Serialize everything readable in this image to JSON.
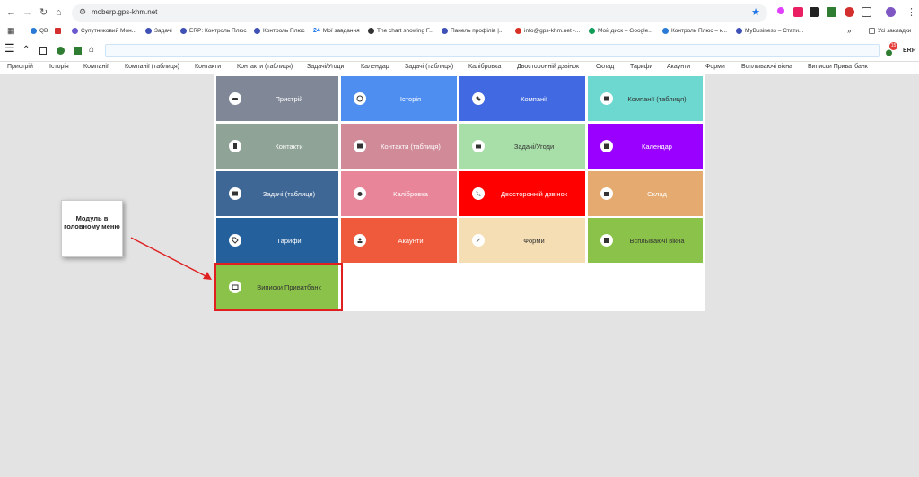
{
  "browser": {
    "url": "moberp.gps-khm.net",
    "bookmarks": [
      {
        "label": "QB",
        "color": "#2a7ad6"
      },
      {
        "label": "Супутниковий Мон...",
        "color": "#6a5acd"
      },
      {
        "label": "Задачі",
        "color": "#3f51b5"
      },
      {
        "label": "ERP: Контроль Плюс",
        "color": "#3f51b5"
      },
      {
        "label": "Контроль Плюс",
        "color": "#3f51b5"
      },
      {
        "label": "Мої завдання",
        "color": "#1a73e8"
      },
      {
        "label": "The chart showing F...",
        "color": "#333333"
      },
      {
        "label": "Панель профілів |...",
        "color": "#3f51b5"
      },
      {
        "label": "info@gps-khm.net -...",
        "color": "#d93025"
      },
      {
        "label": "Мой диск – Google...",
        "color": "#0f9d58"
      },
      {
        "label": "Контроль Плюс – к...",
        "color": "#2a7ad6"
      },
      {
        "label": "MyBusiness – Стати...",
        "color": "#3f51b5"
      }
    ],
    "all_bookmarks": "Усі закладки",
    "bookmark_24": "24"
  },
  "app": {
    "erp_label": "ERP",
    "notification_count": "15",
    "menu": [
      "Пристрій",
      "Історія",
      "Компанії",
      "Компанії (таблиця)",
      "Контакти",
      "Контакти (таблиця)",
      "Задачі/Угоди",
      "Календар",
      "Задачі (таблиця)",
      "Калібровка",
      "Двосторонній дзвінок",
      "Склад",
      "Тарифи",
      "Акаунти",
      "Форми",
      "Всплываючі вікна",
      "Виписки Приватбанк"
    ]
  },
  "modules": [
    {
      "label": "Пристрій",
      "color": "#808898",
      "text_color": "#ffffff",
      "icon": "car-icon"
    },
    {
      "label": "Історія",
      "color": "#4d8ef0",
      "text_color": "#ffffff",
      "icon": "history-icon"
    },
    {
      "label": "Компанії",
      "color": "#4169e1",
      "text_color": "#ffffff",
      "icon": "company-icon"
    },
    {
      "label": "Компанії (таблиця)",
      "color": "#6dd8d0",
      "text_color": "#333333",
      "icon": "table-icon"
    },
    {
      "label": "Контакти",
      "color": "#8fa396",
      "text_color": "#ffffff",
      "icon": "contact-icon"
    },
    {
      "label": "Контакти (таблиця)",
      "color": "#d08a98",
      "text_color": "#ffffff",
      "icon": "table-icon"
    },
    {
      "label": "Задачі/Угоди",
      "color": "#a8dea8",
      "text_color": "#333333",
      "icon": "briefcase-icon"
    },
    {
      "label": "Календар",
      "color": "#9900ff",
      "text_color": "#ffffff",
      "icon": "calendar-icon"
    },
    {
      "label": "Задачі (таблиця)",
      "color": "#3f6796",
      "text_color": "#ffffff",
      "icon": "table-icon"
    },
    {
      "label": "Калібровка",
      "color": "#e88598",
      "text_color": "#ffffff",
      "icon": "drop-icon"
    },
    {
      "label": "Двосторонній дзвінок",
      "color": "#ff0000",
      "text_color": "#ffffff",
      "icon": "phone-icon"
    },
    {
      "label": "Склад",
      "color": "#e5aa70",
      "text_color": "#ffffff",
      "icon": "warehouse-icon"
    },
    {
      "label": "Тарифи",
      "color": "#24619c",
      "text_color": "#ffffff",
      "icon": "tag-icon"
    },
    {
      "label": "Акаунти",
      "color": "#f05a3c",
      "text_color": "#ffffff",
      "icon": "account-icon"
    },
    {
      "label": "Форми",
      "color": "#f5deb3",
      "text_color": "#333333",
      "icon": "link-icon"
    },
    {
      "label": "Всплываючі вікна",
      "color": "#8bc34a",
      "text_color": "#333333",
      "icon": "popup-icon"
    },
    {
      "label": "Виписки Приватбанк",
      "color": "#8bc34a",
      "text_color": "#333333",
      "icon": "bank-icon"
    }
  ],
  "annotation": {
    "callout_text": "Модуль в головному меню",
    "highlight_color": "#e02020"
  }
}
